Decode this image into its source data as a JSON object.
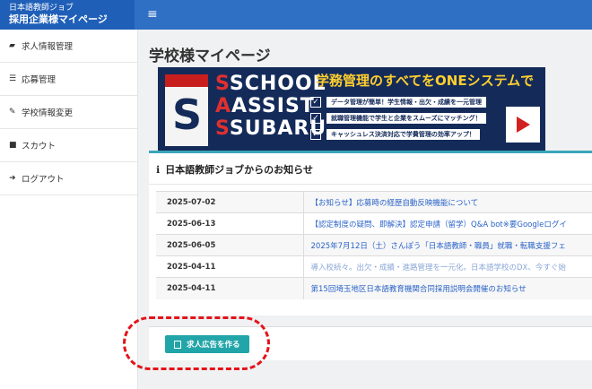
{
  "header": {
    "brand_sub": "日本語教師ジョブ",
    "brand_main": "採用企業様マイページ",
    "menu_icon": "hamburger-icon",
    "color": "#2f6fc4"
  },
  "sidebar": {
    "items": [
      {
        "label": "求人情報管理",
        "icon": "briefcase-icon"
      },
      {
        "label": "応募管理",
        "icon": "list-icon"
      },
      {
        "label": "学校情報変更",
        "icon": "edit-icon"
      },
      {
        "label": "スカウト",
        "icon": "user-icon"
      },
      {
        "label": "ログアウト",
        "icon": "sign-out-icon"
      }
    ]
  },
  "main": {
    "page_title": "学校様マイページ",
    "banner": {
      "logo_lines": [
        "SCHOOL",
        "ASSIST",
        "SUBARU"
      ],
      "logo_initials": [
        "S",
        "A",
        "S"
      ],
      "headline": "学務管理のすべてをONEシステムで",
      "features": [
        "データ管理が簡単！学生情報・出欠・成績を一元管理",
        "就職管理機能で学生と企業をスムーズにマッチング！",
        "キャッシュレス決済対応で学費管理の効率アップ！"
      ]
    },
    "news": {
      "title": "日本語教師ジョブからのお知らせ",
      "rows": [
        {
          "date": "2025-07-02",
          "title": "【お知らせ】応募時の経歴自動反映機能について"
        },
        {
          "date": "2025-06-13",
          "title": "【認定制度の疑問、即解決】認定申請（留学）Q&A bot※要Googleログイ"
        },
        {
          "date": "2025-06-05",
          "title": "2025年7月12日（土）さんぽう「日本語教師・職員」就職・転職支援フェ"
        },
        {
          "date": "2025-04-11",
          "title": "導入校続々。出欠・成績・進路管理を一元化。日本語学校のDX、今すぐ始"
        },
        {
          "date": "2025-04-11",
          "title": "第15回埼玉地区日本語教育機関合同採用説明会開催のお知らせ"
        }
      ]
    },
    "create_button": "求人広告を作る"
  },
  "colors": {
    "accent": "#22a5a8",
    "link": "#2a63c8",
    "highlight": "#e3141b",
    "banner_bg": "#142b5a"
  }
}
